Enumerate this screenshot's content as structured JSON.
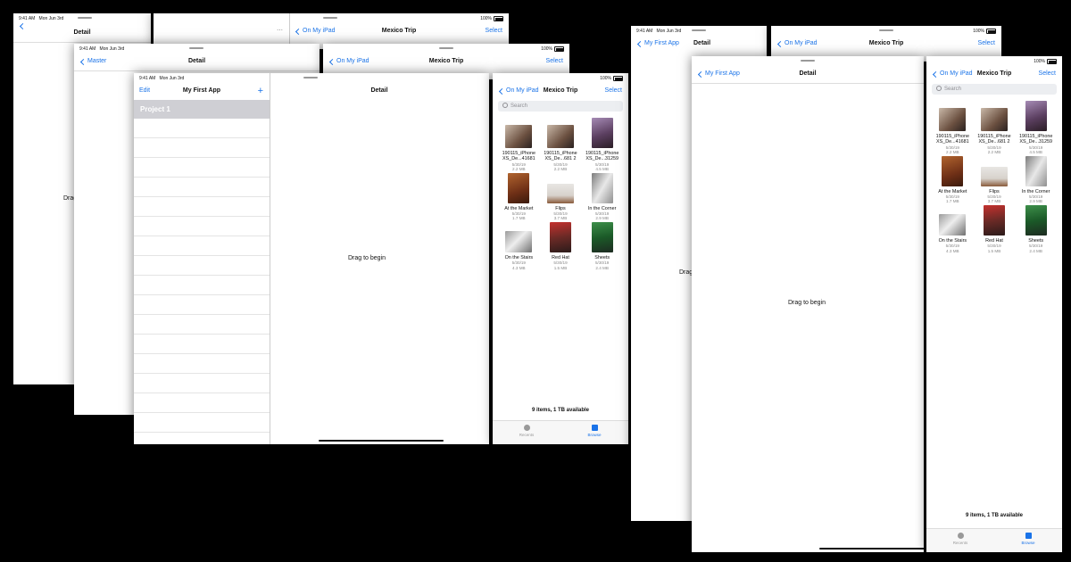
{
  "colors": {
    "accent": "#1a73e8",
    "background": "#000000"
  },
  "status": {
    "time": "9:41 AM",
    "date": "Mon Jun 3rd",
    "battery": "100%"
  },
  "icons": {
    "back": "chevron-left-icon",
    "add": "plus-icon",
    "more": "ellipsis-icon",
    "search": "search-icon",
    "recents": "clock-icon",
    "browse": "folder-icon"
  },
  "nav": {
    "detail": "Detail",
    "master": "Master",
    "app_title": "My First App",
    "edit": "Edit",
    "files_title": "Mexico Trip",
    "back_files": "On My iPad",
    "select": "Select",
    "back_app": "My First App"
  },
  "sidebar": {
    "items": [
      "Project 1"
    ]
  },
  "detail": {
    "empty": "Drag to begin",
    "empty_partial": "Drag"
  },
  "files": {
    "search_placeholder": "Search",
    "items": [
      {
        "name1": "190115_iPhone",
        "name2": "XS_De...41681",
        "date": "5/30/19",
        "size": "2.2 MB"
      },
      {
        "name1": "190115_iPhone",
        "name2": "XS_De...681 2",
        "date": "5/30/19",
        "size": "2.2 MB"
      },
      {
        "name1": "190115_iPhone",
        "name2": "XS_De...31259",
        "date": "5/30/19",
        "size": "4.5 MB"
      },
      {
        "name1": "At the Market",
        "name2": "",
        "date": "5/30/19",
        "size": "1.7 MB"
      },
      {
        "name1": "Flips",
        "name2": "",
        "date": "5/30/19",
        "size": "3.7 MB"
      },
      {
        "name1": "In the Corner",
        "name2": "",
        "date": "5/30/19",
        "size": "2.9 MB"
      },
      {
        "name1": "On the Stairs",
        "name2": "",
        "date": "5/30/19",
        "size": "4.3 MB"
      },
      {
        "name1": "Red Hat",
        "name2": "",
        "date": "5/30/19",
        "size": "1.5 MB"
      },
      {
        "name1": "Sheets",
        "name2": "",
        "date": "5/30/19",
        "size": "2.4 MB"
      }
    ],
    "summary": "9 items, 1 TB available"
  },
  "tabs": {
    "recents": "Recents",
    "browse": "Browse"
  }
}
